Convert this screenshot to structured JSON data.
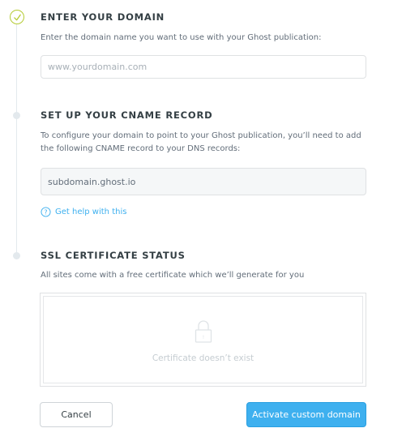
{
  "steps": [
    {
      "title": "ENTER YOUR DOMAIN",
      "description": "Enter the domain name you want to use with your Ghost publication:",
      "input_placeholder": "www.yourdomain.com",
      "input_value": ""
    },
    {
      "title": "SET UP YOUR CNAME RECORD",
      "description": "To configure your domain to point to your Ghost publication, you’ll need to add the following CNAME record to your DNS records:",
      "cname_value": "subdomain.ghost.io",
      "help_link": "Get help with this"
    },
    {
      "title": "SSL CERTIFICATE STATUS",
      "description": "All sites come with a free certificate which we’ll generate for you",
      "certificate_status": "Certificate doesn’t exist"
    }
  ],
  "buttons": {
    "cancel": "Cancel",
    "activate": "Activate custom domain"
  },
  "colors": {
    "accent": "#3eb0ef",
    "check": "#b4cb32",
    "timeline": "#e3e9ed"
  },
  "icons": {
    "step1": "check-circle-icon",
    "help": "question-circle-icon",
    "certificate": "lock-icon"
  }
}
